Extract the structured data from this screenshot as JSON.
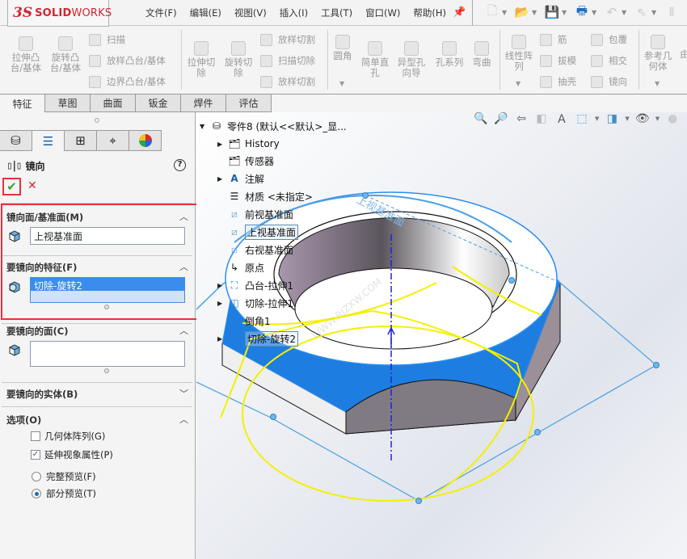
{
  "app": {
    "logo_ds": "3S",
    "logo_solid": "SOLID",
    "logo_works": "WORKS"
  },
  "menu": [
    {
      "label": "文件(F)"
    },
    {
      "label": "编辑(E)"
    },
    {
      "label": "视图(V)"
    },
    {
      "label": "插入(I)"
    },
    {
      "label": "工具(T)"
    },
    {
      "label": "窗口(W)"
    },
    {
      "label": "帮助(H)"
    }
  ],
  "quick_access": [
    {
      "icon": "new-document-icon"
    },
    {
      "icon": "open-folder-icon"
    },
    {
      "icon": "save-icon"
    },
    {
      "icon": "print-icon"
    },
    {
      "icon": "undo-icon"
    },
    {
      "icon": "select-pointer-icon"
    },
    {
      "icon": "rebuild-icon"
    }
  ],
  "ribbon": {
    "extrude_boss": "拉伸凸\n台/基体",
    "revolve_boss": "旋转凸\n台/基体",
    "sweep": "扫描",
    "loft_boss": "放样凸台/基体",
    "boundary_boss": "边界凸台/基体",
    "extrude_cut": "拉伸切\n除",
    "revolve_cut": "旋转切\n除",
    "loft_cut_1": "放样切割",
    "sweep_cut": "扫描切除",
    "loft_cut_2": "放样切割",
    "fillet": "圆角",
    "simple_hole": "简单直\n孔",
    "hole_wizard": "异型孔\n向导",
    "hole_series": "孔系列",
    "flex": "弯曲",
    "linear_pattern": "线性阵\n列",
    "rib": "筋",
    "wrap": "包覆",
    "draft": "拔模",
    "intersect": "相交",
    "shell": "抽壳",
    "mirror": "镜向",
    "ref_geometry": "参考几\n何体",
    "curves_partial": "由"
  },
  "tabs": [
    {
      "label": "特征",
      "active": true
    },
    {
      "label": "草图"
    },
    {
      "label": "曲面"
    },
    {
      "label": "钣金"
    },
    {
      "label": "焊件"
    },
    {
      "label": "评估"
    }
  ],
  "panel_tabs": [
    {
      "icon": "feature-manager-icon"
    },
    {
      "icon": "property-manager-icon",
      "active": true
    },
    {
      "icon": "configuration-manager-icon"
    },
    {
      "icon": "dimxpert-icon"
    },
    {
      "icon": "display-manager-icon"
    }
  ],
  "property_manager": {
    "title": "镜向",
    "help": "?",
    "ok": "✔",
    "cancel": "✕",
    "mirror_plane": {
      "title": "镜向面/基准面(M)",
      "value": "上视基准面"
    },
    "features_to_mirror": {
      "title": "要镜向的特征(F)",
      "items": [
        "切除-旋转2"
      ]
    },
    "faces_to_mirror": {
      "title": "要镜向的面(C)",
      "value": ""
    },
    "bodies_to_mirror": {
      "title": "要镜向的实体(B)"
    },
    "options": {
      "title": "选项(O)",
      "geometry_pattern": {
        "label": "几何体阵列(G)",
        "checked": false
      },
      "propagate_visual": {
        "label": "延伸视象属性(P)",
        "checked": true
      },
      "full_preview": {
        "label": "完整预览(F)",
        "selected": false
      },
      "partial_preview": {
        "label": "部分预览(T)",
        "selected": true
      }
    }
  },
  "feature_tree": {
    "root": "零件8 (默认<<默认>_显...",
    "items": [
      {
        "label": "History",
        "icon": "history-folder-icon",
        "expandable": true
      },
      {
        "label": "传感器",
        "icon": "sensors-folder-icon",
        "expandable": false
      },
      {
        "label": "注解",
        "icon": "annotations-folder-icon",
        "expandable": true
      },
      {
        "label": "材质 <未指定>",
        "icon": "material-icon",
        "expandable": false
      },
      {
        "label": "前视基准面",
        "icon": "plane-icon",
        "expandable": false
      },
      {
        "label": "上视基准面",
        "icon": "plane-icon",
        "expandable": false,
        "selected": true
      },
      {
        "label": "右视基准面",
        "icon": "plane-icon",
        "expandable": false
      },
      {
        "label": "原点",
        "icon": "origin-icon",
        "expandable": false
      },
      {
        "label": "凸台-拉伸1",
        "icon": "extrude-boss-icon",
        "expandable": true
      },
      {
        "label": "切除-拉伸1",
        "icon": "extrude-cut-icon",
        "expandable": true
      },
      {
        "label": "倒角1",
        "icon": "chamfer-icon",
        "expandable": false
      },
      {
        "label": "切除-旋转2",
        "icon": "revolve-cut-icon",
        "expandable": true,
        "selected": true
      }
    ]
  },
  "viewport": {
    "plane_label": "上视基准面",
    "watermark": "WWW.RJZXW.COM",
    "colors": {
      "highlight": "#1e7de0",
      "preview": "#f4f000",
      "plane": "#4a9fe8",
      "axis": "#2222dd"
    }
  }
}
